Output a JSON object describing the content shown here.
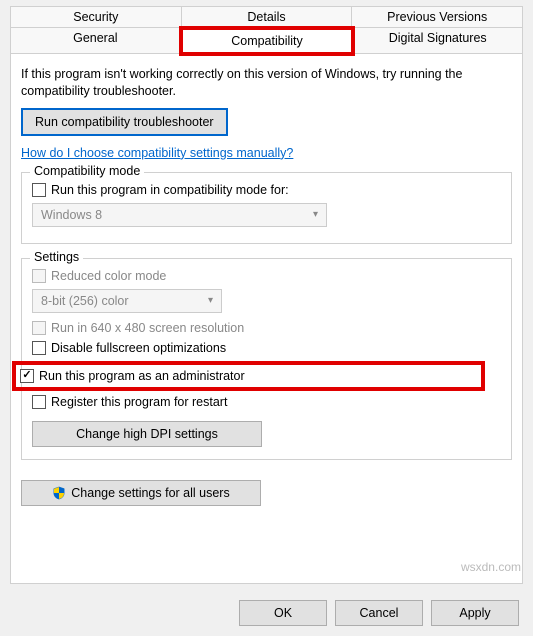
{
  "tabs": {
    "row1": [
      "Security",
      "Details",
      "Previous Versions"
    ],
    "row2": [
      "General",
      "Compatibility",
      "Digital Signatures"
    ],
    "active": "Compatibility"
  },
  "helpText": "If this program isn't working correctly on this version of Windows, try running the compatibility troubleshooter.",
  "troubleshootBtn": "Run compatibility troubleshooter",
  "manualLink": "How do I choose compatibility settings manually?",
  "compatMode": {
    "title": "Compatibility mode",
    "checkbox": "Run this program in compatibility mode for:",
    "selectValue": "Windows 8"
  },
  "settings": {
    "title": "Settings",
    "reducedColor": "Reduced color mode",
    "colorSelect": "8-bit (256) color",
    "run640": "Run in 640 x 480 screen resolution",
    "disableFullscreen": "Disable fullscreen optimizations",
    "runAsAdmin": "Run this program as an administrator",
    "registerRestart": "Register this program for restart",
    "changeDPI": "Change high DPI settings"
  },
  "changeAllUsers": "Change settings for all users",
  "footer": {
    "ok": "OK",
    "cancel": "Cancel",
    "apply": "Apply"
  },
  "watermark": "wsxdn.com"
}
